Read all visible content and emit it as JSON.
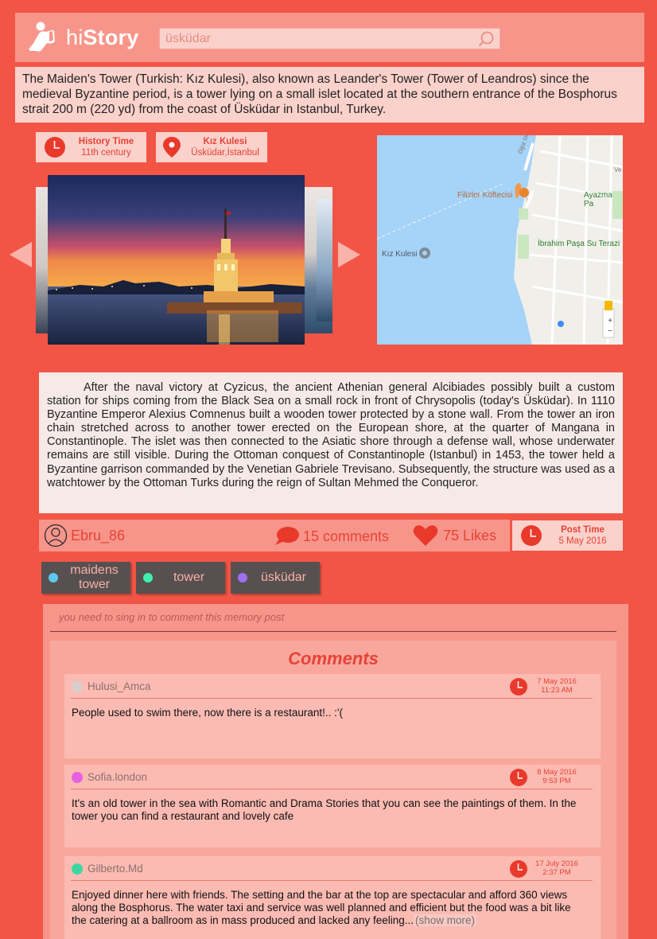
{
  "app": {
    "logo_text_hi": "hi",
    "logo_text_story": "Story",
    "search_value": "üsküdar"
  },
  "intro": "The Maiden's Tower (Turkish: Kız Kulesi), also known as Leander's Tower (Tower of Leandros) since the medieval Byzantine period, is a tower lying on a small islet located at the southern entrance of the Bosphorus strait 200 m (220 yd) from the coast of Üsküdar in Istanbul, Turkey.",
  "history_time": {
    "title": "History Time",
    "value": "11th century"
  },
  "location": {
    "title": "Kız Kulesi",
    "value": "Üsküdar,İstanbul"
  },
  "map": {
    "labels": [
      "Filizler Köftecisi",
      "Ayazma Pa",
      "Kız Kulesi",
      "İbrahim Paşa Su Terazi",
      "Ve",
      "Öğüt Sk"
    ],
    "zoom_in": "+",
    "zoom_out": "−"
  },
  "story": "After the naval victory at Cyzicus, the ancient Athenian general Alcibiades possibly built a custom station for ships coming from the Black Sea on a small rock in front of Chrysopolis (today's Üsküdar). In 1110 Byzantine Emperor Alexius Comnenus built a wooden tower protected by a stone wall. From the tower an iron chain stretched across to another tower erected on the European shore, at the quarter of Mangana in Constantinople. The islet was then connected to the Asiatic shore through a defense wall, whose underwater remains are still visible. During the Ottoman conquest of Constantinople (Istanbul) in 1453, the tower held a Byzantine garrison commanded by the Venetian Gabriele Trevisano. Subsequently, the structure was used as a watchtower by the Ottoman Turks during the reign of Sultan Mehmed the Conqueror.",
  "post": {
    "author": "Ebru_86",
    "comments": "15 comments",
    "likes": "75 Likes",
    "time_title": "Post Time",
    "time_value": "5 May 2016"
  },
  "tags": [
    {
      "label": "maidens tower",
      "color": "#5ec8f0"
    },
    {
      "label": "tower",
      "color": "#3ef0b0"
    },
    {
      "label": "üsküdar",
      "color": "#a070f0"
    }
  ],
  "comments_section": {
    "signin_note": "you need to sing in to comment this memory post",
    "title": "Comments",
    "items": [
      {
        "user": "Hulusi_Amca",
        "avatar_color": "#d6cfcd",
        "date": "7 May 2016",
        "time": "11:23 AM",
        "text": "People used to swim there, now there is a restaurant!.. :'("
      },
      {
        "user": "Sofia.london",
        "avatar_color": "#e860e0",
        "date": "8 May 2016",
        "time": "9:53 PM",
        "text": "It's an old tower in the sea with Romantic and Drama Stories that you can see the paintings of them. In the tower you can find a restaurant and lovely cafe"
      },
      {
        "user": "Gilberto.Md",
        "avatar_color": "#3ed6a0",
        "date": "17 July 2016",
        "time": "2:37 PM",
        "text": "Enjoyed dinner here with friends. The setting and the bar at the top are spectacular and afford 360 views along the Bosphorus. The water taxi and service was well planned and efficient but the food was a bit like the catering at a ballroom as in mass produced and lacked any feeling...",
        "more": "(show more)"
      }
    ]
  },
  "colors": {
    "background": "#f25546",
    "accent": "#e64336",
    "panel": "#fbd1cb",
    "tag_bg": "#575050"
  }
}
